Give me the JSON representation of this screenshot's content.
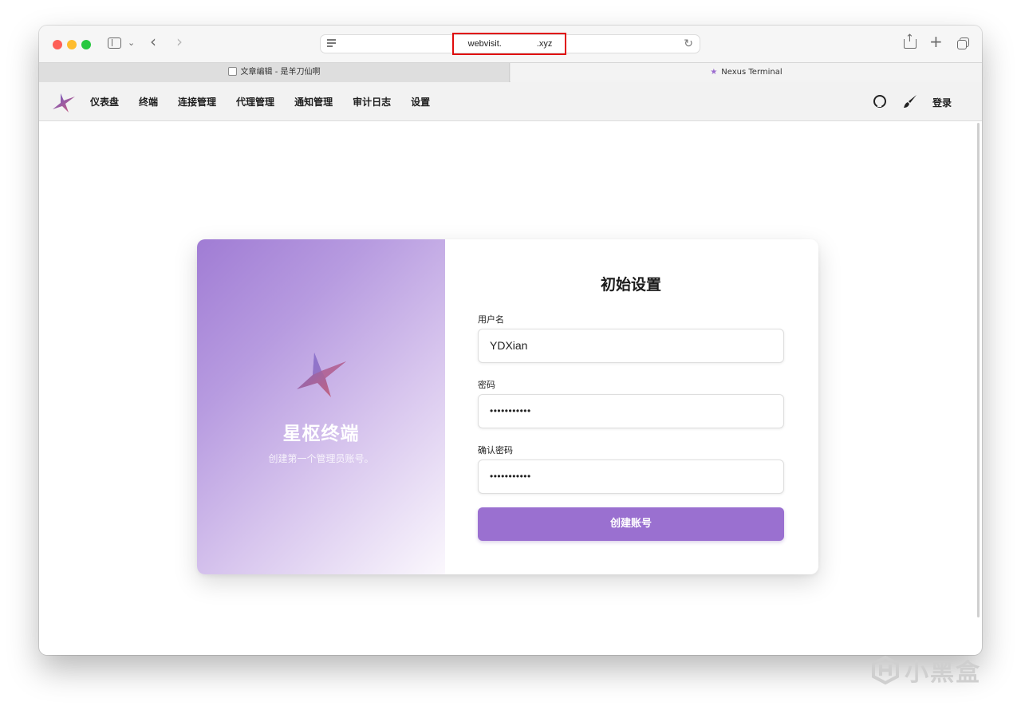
{
  "browser": {
    "url_prefix": "webvisit.",
    "url_suffix": ".xyz",
    "tabs": [
      {
        "label": "文章编辑 - 是羊刀仙啊"
      },
      {
        "label": "Nexus Terminal"
      }
    ]
  },
  "nav": {
    "items": [
      "仪表盘",
      "终端",
      "连接管理",
      "代理管理",
      "通知管理",
      "审计日志",
      "设置"
    ],
    "login": "登录"
  },
  "brand": {
    "name": "星枢终端",
    "subtitle": "创建第一个管理员账号。"
  },
  "form": {
    "title": "初始设置",
    "username_label": "用户名",
    "username_value": "YDXian",
    "password_label": "密码",
    "password_value": "•••••••••••",
    "confirm_label": "确认密码",
    "confirm_value": "•••••••••••",
    "submit_label": "创建账号"
  },
  "watermark": {
    "text": "小黑盒"
  },
  "colors": {
    "accent": "#9a70d0",
    "highlight_box": "#e00b0b"
  }
}
